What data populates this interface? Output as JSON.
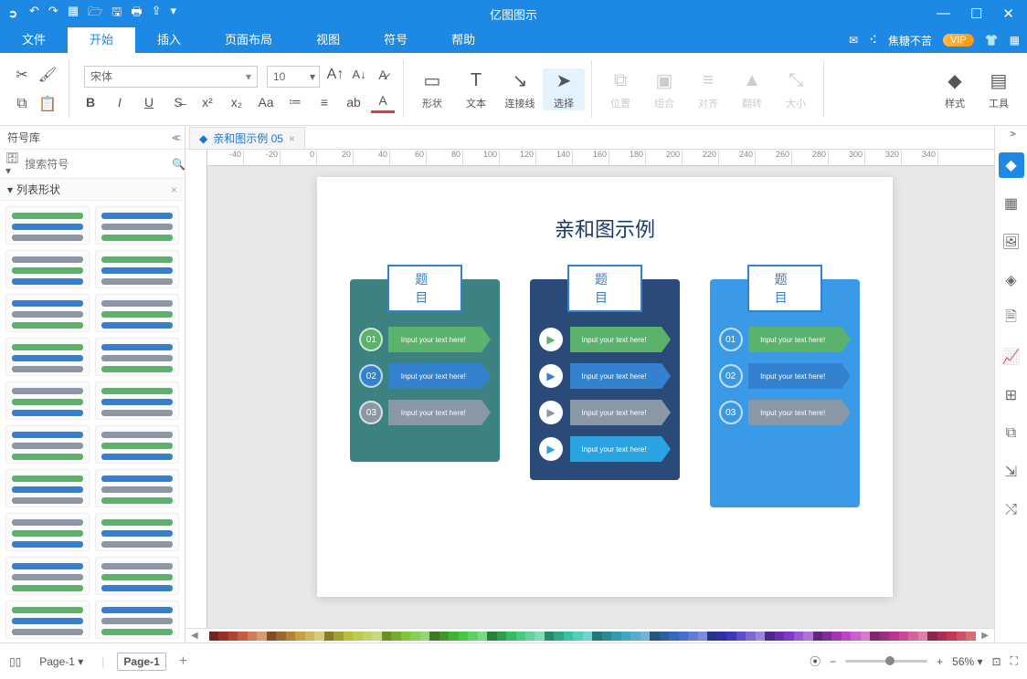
{
  "app": {
    "title": "亿图图示"
  },
  "qat": [
    "↶",
    "↷",
    "▦",
    "🗁",
    "🖫",
    "🖶",
    "⇪",
    "▾"
  ],
  "wincontrols": [
    "—",
    "☐",
    "✕"
  ],
  "menus": {
    "items": [
      "文件",
      "开始",
      "插入",
      "页面布局",
      "视图",
      "符号",
      "帮助"
    ],
    "active": 1
  },
  "menuRight": {
    "user": "焦糖不苦",
    "vip": "VIP"
  },
  "ribbon": {
    "font_family": "宋体",
    "font_size": "10",
    "bigtools": [
      {
        "label": "形状",
        "glyph": "▭",
        "active": false,
        "disabled": false
      },
      {
        "label": "文本",
        "glyph": "T",
        "active": false,
        "disabled": false
      },
      {
        "label": "连接线",
        "glyph": "↘",
        "active": false,
        "disabled": false
      },
      {
        "label": "选择",
        "glyph": "➤",
        "active": true,
        "disabled": false
      },
      {
        "label": "位置",
        "glyph": "⧉",
        "active": false,
        "disabled": true
      },
      {
        "label": "组合",
        "glyph": "▣",
        "active": false,
        "disabled": true
      },
      {
        "label": "对齐",
        "glyph": "≡",
        "active": false,
        "disabled": true
      },
      {
        "label": "翻转",
        "glyph": "▲",
        "active": false,
        "disabled": true
      },
      {
        "label": "大小",
        "glyph": "⤡",
        "active": false,
        "disabled": true
      },
      {
        "label": "样式",
        "glyph": "◆",
        "active": false,
        "disabled": false
      },
      {
        "label": "工具",
        "glyph": "▤",
        "active": false,
        "disabled": false
      }
    ]
  },
  "left": {
    "title": "符号库",
    "search_placeholder": "搜索符号",
    "category": "列表形状"
  },
  "doc": {
    "tab_title": "亲和图示例 05",
    "page_title": "亲和图示例",
    "ruler": [
      "-40",
      "-20",
      "0",
      "20",
      "40",
      "60",
      "80",
      "100",
      "120",
      "140",
      "160",
      "180",
      "200",
      "220",
      "240",
      "260",
      "280",
      "300",
      "320",
      "340"
    ],
    "cards": [
      {
        "title": "题目",
        "bg": "#3b8281",
        "tab": "#3481d0",
        "rows": [
          {
            "num": "01",
            "text": "Input your text here!",
            "bg": "#5ab26c",
            "accent": "#3b8281"
          },
          {
            "num": "02",
            "text": "Input your text here!",
            "bg": "#3481d0",
            "accent": "#3b8281"
          },
          {
            "num": "03",
            "text": "Input your text here!",
            "bg": "#8a97a4",
            "accent": "#3b8281"
          }
        ]
      },
      {
        "title": "题目",
        "bg": "#2a4b78",
        "tab": "#3481d0",
        "rows": [
          {
            "text": "Input your text here!",
            "bg": "#5ab26c"
          },
          {
            "text": "Input your text here!",
            "bg": "#3481d0"
          },
          {
            "text": "Input your text here!",
            "bg": "#8a97a4"
          },
          {
            "text": "Input your text here!",
            "bg": "#2aa3e2"
          }
        ]
      },
      {
        "title": "题目",
        "bg": "#3a9ae8",
        "tab": "#3481d0",
        "rows": [
          {
            "num": "01",
            "text": "Input your text here!",
            "bg": "#5ab26c"
          },
          {
            "num": "02",
            "text": "Input your text here!",
            "bg": "#3481d0"
          },
          {
            "num": "03",
            "text": "Input your text here!",
            "bg": "#8a97a4"
          }
        ]
      }
    ]
  },
  "status": {
    "page_combo": "Page-1",
    "pages": [
      "Page-1"
    ],
    "zoom": "56%"
  }
}
